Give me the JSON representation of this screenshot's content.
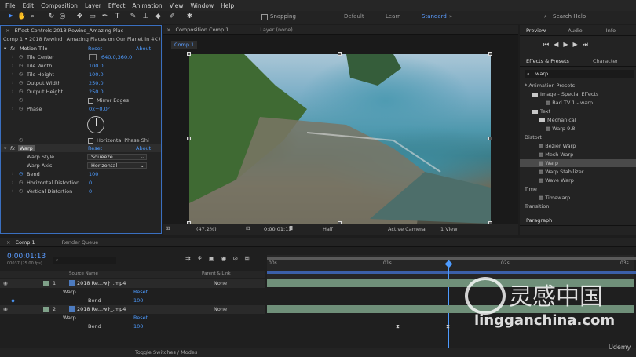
{
  "menu": [
    "File",
    "Edit",
    "Composition",
    "Layer",
    "Effect",
    "Animation",
    "View",
    "Window",
    "Help"
  ],
  "toolbar": {
    "snapping_label": "Snapping",
    "workspaces": [
      "Default",
      "Learn",
      "Standard"
    ],
    "active_workspace": "Standard",
    "search_placeholder": "Search Help"
  },
  "effect_controls": {
    "tab_title": "Effect Controls 2018 Rewind_Amazing Plac",
    "breadcrumb": "Comp 1 • 2018 Rewind_ Amazing Places on Our Planet in 4K Ul",
    "motion_tile": {
      "name": "Motion Tile",
      "reset": "Reset",
      "about": "About",
      "props": [
        {
          "label": "Tile Center",
          "value": "640.0,360.0"
        },
        {
          "label": "Tile Width",
          "value": "100.0"
        },
        {
          "label": "Tile Height",
          "value": "100.0"
        },
        {
          "label": "Output Width",
          "value": "250.0"
        },
        {
          "label": "Output Height",
          "value": "250.0"
        }
      ],
      "mirror_edges": "Mirror Edges",
      "phase_label": "Phase",
      "phase_value": "0x+0.0°",
      "hphase": "Horizontal Phase Shi"
    },
    "warp": {
      "name": "Warp",
      "reset": "Reset",
      "about": "About",
      "style_label": "Warp Style",
      "style_value": "Squeeze",
      "axis_label": "Warp Axis",
      "axis_value": "Horizontal",
      "bend_label": "Bend",
      "bend_value": "100",
      "hdist_label": "Horizontal Distortion",
      "hdist_value": "0",
      "vdist_label": "Vertical Distortion",
      "vdist_value": "0"
    }
  },
  "composition": {
    "tab": "Composition Comp 1",
    "layer_tab": "Layer (none)",
    "comp_button": "Comp 1",
    "zoom": "(47.2%)",
    "timecode": "0:00:01:13",
    "resolution": "Half",
    "camera": "Active Camera",
    "views": "1 View"
  },
  "preview": {
    "tabs": [
      "Preview",
      "Audio",
      "Info"
    ]
  },
  "effects_presets": {
    "tabs": [
      "Effects & Presets",
      "Character"
    ],
    "search_value": "warp",
    "items": [
      {
        "text": "* Animation Presets",
        "indent": 0,
        "type": "group"
      },
      {
        "text": "Image - Special Effects",
        "indent": 1,
        "type": "folder"
      },
      {
        "text": "Bad TV 1 - warp",
        "indent": 3,
        "type": "effect"
      },
      {
        "text": "Text",
        "indent": 1,
        "type": "folder"
      },
      {
        "text": "Mechanical",
        "indent": 2,
        "type": "folder"
      },
      {
        "text": "Warp 9.8",
        "indent": 3,
        "type": "effect"
      },
      {
        "text": "Distort",
        "indent": 0,
        "type": "group"
      },
      {
        "text": "Bezier Warp",
        "indent": 2,
        "type": "effect"
      },
      {
        "text": "Mesh Warp",
        "indent": 2,
        "type": "effect"
      },
      {
        "text": "Warp",
        "indent": 2,
        "type": "effect",
        "selected": true
      },
      {
        "text": "Warp Stabilizer",
        "indent": 2,
        "type": "effect"
      },
      {
        "text": "Wave Warp",
        "indent": 2,
        "type": "effect"
      },
      {
        "text": "Time",
        "indent": 0,
        "type": "group"
      },
      {
        "text": "Timewarp",
        "indent": 2,
        "type": "effect"
      },
      {
        "text": "Transition",
        "indent": 0,
        "type": "group"
      }
    ],
    "paragraph_tab": "Paragraph"
  },
  "timeline": {
    "tabs": [
      "Comp 1",
      "Render Queue"
    ],
    "timecode": "0:00:01:13",
    "frames": "00037 (25.00 fps)",
    "col_source": "Source Name",
    "col_parent": "Parent & Link",
    "ruler": [
      "00s",
      "01s",
      "02s",
      "03s"
    ],
    "layers": [
      {
        "num": "1",
        "name": "2018 Re...w}_.mp4",
        "parent": "None",
        "effect": "Warp",
        "reset": "Reset",
        "prop": "Bend",
        "value": "100"
      },
      {
        "num": "2",
        "name": "2018 Re...w}_.mp4",
        "parent": "None",
        "effect": "Warp",
        "reset": "Reset",
        "prop": "Bend",
        "value": "100"
      }
    ],
    "footer": "Toggle Switches / Modes"
  },
  "watermark": {
    "cn": "灵感中国",
    "url": "lingganchina.com",
    "brand": "Udemy"
  },
  "colors": {
    "accent": "#4d9bff",
    "panel": "#232323",
    "track_green": "#7fa189"
  }
}
